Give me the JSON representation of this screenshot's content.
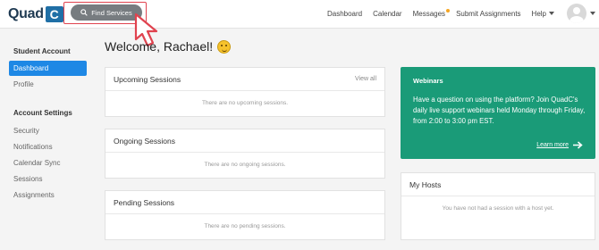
{
  "header": {
    "logo_text": "Quad",
    "logo_box": "C",
    "find_services_label": "Find Services",
    "nav": [
      "Dashboard",
      "Calendar",
      "Messages",
      "Submit Assignments"
    ],
    "help_label": "Help"
  },
  "sidebar": {
    "student_heading": "Student Account",
    "student_items": [
      "Dashboard",
      "Profile"
    ],
    "settings_heading": "Account Settings",
    "settings_items": [
      "Security",
      "Notifications",
      "Calendar Sync",
      "Sessions",
      "Assignments"
    ]
  },
  "main": {
    "welcome": "Welcome, Rachael!",
    "upcoming": {
      "title": "Upcoming Sessions",
      "link": "View all",
      "empty": "There are no upcoming sessions."
    },
    "ongoing": {
      "title": "Ongoing Sessions",
      "empty": "There are no ongoing sessions."
    },
    "pending": {
      "title": "Pending Sessions",
      "empty": "There are no pending sessions."
    }
  },
  "webinars": {
    "title": "Webinars",
    "body": "Have a question on using the platform? Join QuadC's daily live support webinars held Monday through Friday, from 2:00 to 3:00 pm EST.",
    "learn_more": "Learn more"
  },
  "hosts": {
    "title": "My Hosts",
    "empty": "You have not had a session with a host yet."
  },
  "colors": {
    "accent_blue": "#1e88e5",
    "webinar_green": "#1a9b78",
    "highlight_red": "#e0434f",
    "notification_dot": "#f5a623"
  }
}
